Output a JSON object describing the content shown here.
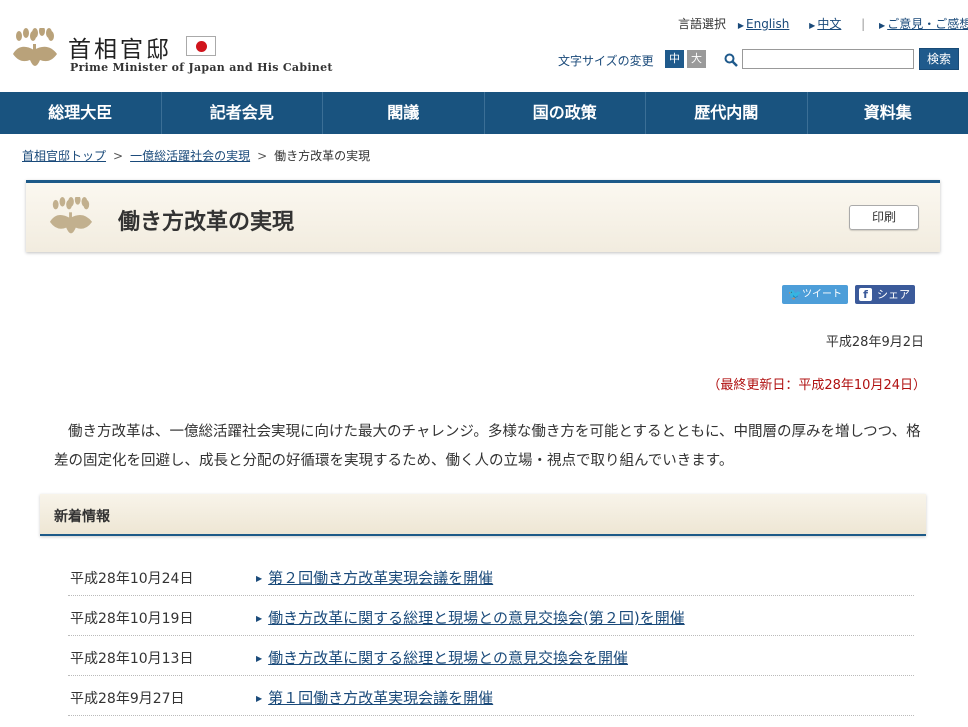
{
  "header": {
    "site_title": "首相官邸",
    "site_subtitle": "Prime Minister of Japan and His Cabinet",
    "lang_label": "言語選択",
    "lang_english": "English",
    "lang_chinese": "中文",
    "opinion_link": "ご意見・ご感想",
    "font_size_label": "文字サイズの変更",
    "font_mid": "中",
    "font_big": "大",
    "search_placeholder": "",
    "search_button": "検索"
  },
  "nav": {
    "items": [
      "総理大臣",
      "記者会見",
      "閣議",
      "国の政策",
      "歴代内閣",
      "資料集"
    ]
  },
  "breadcrumb": {
    "home": "首相官邸トップ",
    "parent": "一億総活躍社会の実現",
    "current": "働き方改革の実現",
    "sep": ">"
  },
  "page": {
    "title": "働き方改革の実現",
    "print_label": "印刷",
    "tweet_label": "ツイート",
    "share_label": "シェア",
    "date": "平成28年9月2日",
    "updated": "（最終更新日：平成28年10月24日）",
    "intro": "働き方改革は、一億総活躍社会実現に向けた最大のチャレンジ。多様な働き方を可能とするとともに、中間層の厚みを増しつつ、格差の固定化を回避し、成長と分配の好循環を実現するため、働く人の立場・視点で取り組んでいきます。"
  },
  "news": {
    "heading": "新着情報",
    "items": [
      {
        "date": "平成28年10月24日",
        "title": "第２回働き方改革実現会議を開催"
      },
      {
        "date": "平成28年10月19日",
        "title": "働き方改革に関する総理と現場との意見交換会(第２回)を開催"
      },
      {
        "date": "平成28年10月13日",
        "title": "働き方改革に関する総理と現場との意見交換会を開催"
      },
      {
        "date": "平成28年9月27日",
        "title": "第１回働き方改革実現会議を開催"
      }
    ]
  },
  "colors": {
    "nav_bg": "#19537f",
    "link": "#1a4a7a",
    "updated_red": "#b01010"
  }
}
